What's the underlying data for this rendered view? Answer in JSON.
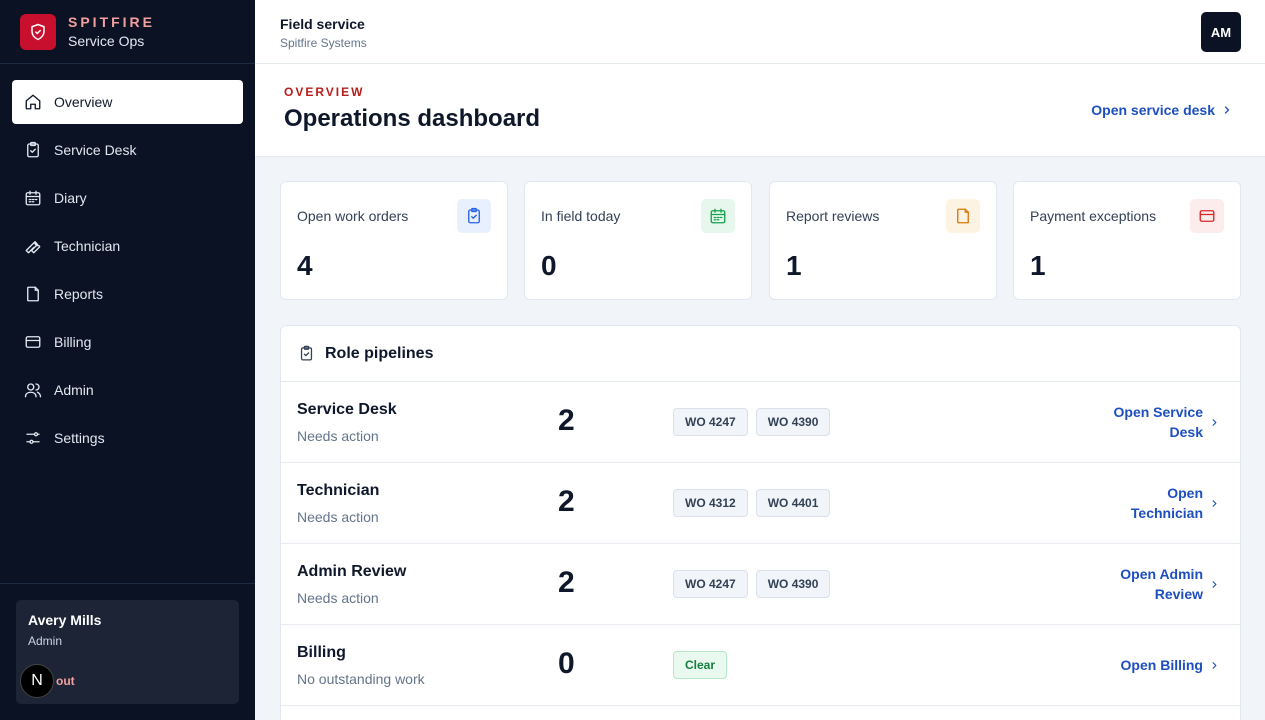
{
  "brand": {
    "name": "SPITFIRE",
    "sub": "Service Ops"
  },
  "nav": [
    {
      "label": "Overview",
      "icon": "home-icon",
      "active": true
    },
    {
      "label": "Service Desk",
      "icon": "clipboard-icon"
    },
    {
      "label": "Diary",
      "icon": "calendar-icon"
    },
    {
      "label": "Technician",
      "icon": "wrench-icon"
    },
    {
      "label": "Reports",
      "icon": "document-icon"
    },
    {
      "label": "Billing",
      "icon": "credit-card-icon"
    },
    {
      "label": "Admin",
      "icon": "users-icon"
    },
    {
      "label": "Settings",
      "icon": "sliders-icon"
    }
  ],
  "user": {
    "name": "Avery Mills",
    "role": "Admin",
    "signout": "out",
    "badge": "N"
  },
  "topbar": {
    "title": "Field service",
    "subtitle": "Spitfire Systems",
    "avatar": "AM"
  },
  "header": {
    "eyebrow": "OVERVIEW",
    "title": "Operations dashboard",
    "link": "Open service desk"
  },
  "stats": [
    {
      "label": "Open work orders",
      "value": "4",
      "icon": "clipboard-check-icon",
      "color": "#2563eb",
      "bg": "#e8f0fe"
    },
    {
      "label": "In field today",
      "value": "0",
      "icon": "calendar-icon",
      "color": "#16a34a",
      "bg": "#e7f7ee"
    },
    {
      "label": "Report reviews",
      "value": "1",
      "icon": "document-icon",
      "color": "#d97706",
      "bg": "#fdf3e3"
    },
    {
      "label": "Payment exceptions",
      "value": "1",
      "icon": "credit-card-icon",
      "color": "#dc2626",
      "bg": "#fdecec"
    }
  ],
  "pipelines": {
    "title": "Role pipelines",
    "rows": [
      {
        "name": "Service Desk",
        "sub": "Needs action",
        "count": "2",
        "chips": [
          "WO 4247",
          "WO 4390"
        ],
        "link_lines": [
          "Open Service",
          "Desk"
        ]
      },
      {
        "name": "Technician",
        "sub": "Needs action",
        "count": "2",
        "chips": [
          "WO 4312",
          "WO 4401"
        ],
        "link_lines": [
          "Open",
          "Technician"
        ]
      },
      {
        "name": "Admin Review",
        "sub": "Needs action",
        "count": "2",
        "chips": [
          "WO 4247",
          "WO 4390"
        ],
        "link_lines": [
          "Open Admin",
          "Review"
        ]
      },
      {
        "name": "Billing",
        "sub": "No outstanding work",
        "count": "0",
        "clear": "Clear",
        "link_lines": [
          "Open Billing"
        ]
      }
    ]
  }
}
